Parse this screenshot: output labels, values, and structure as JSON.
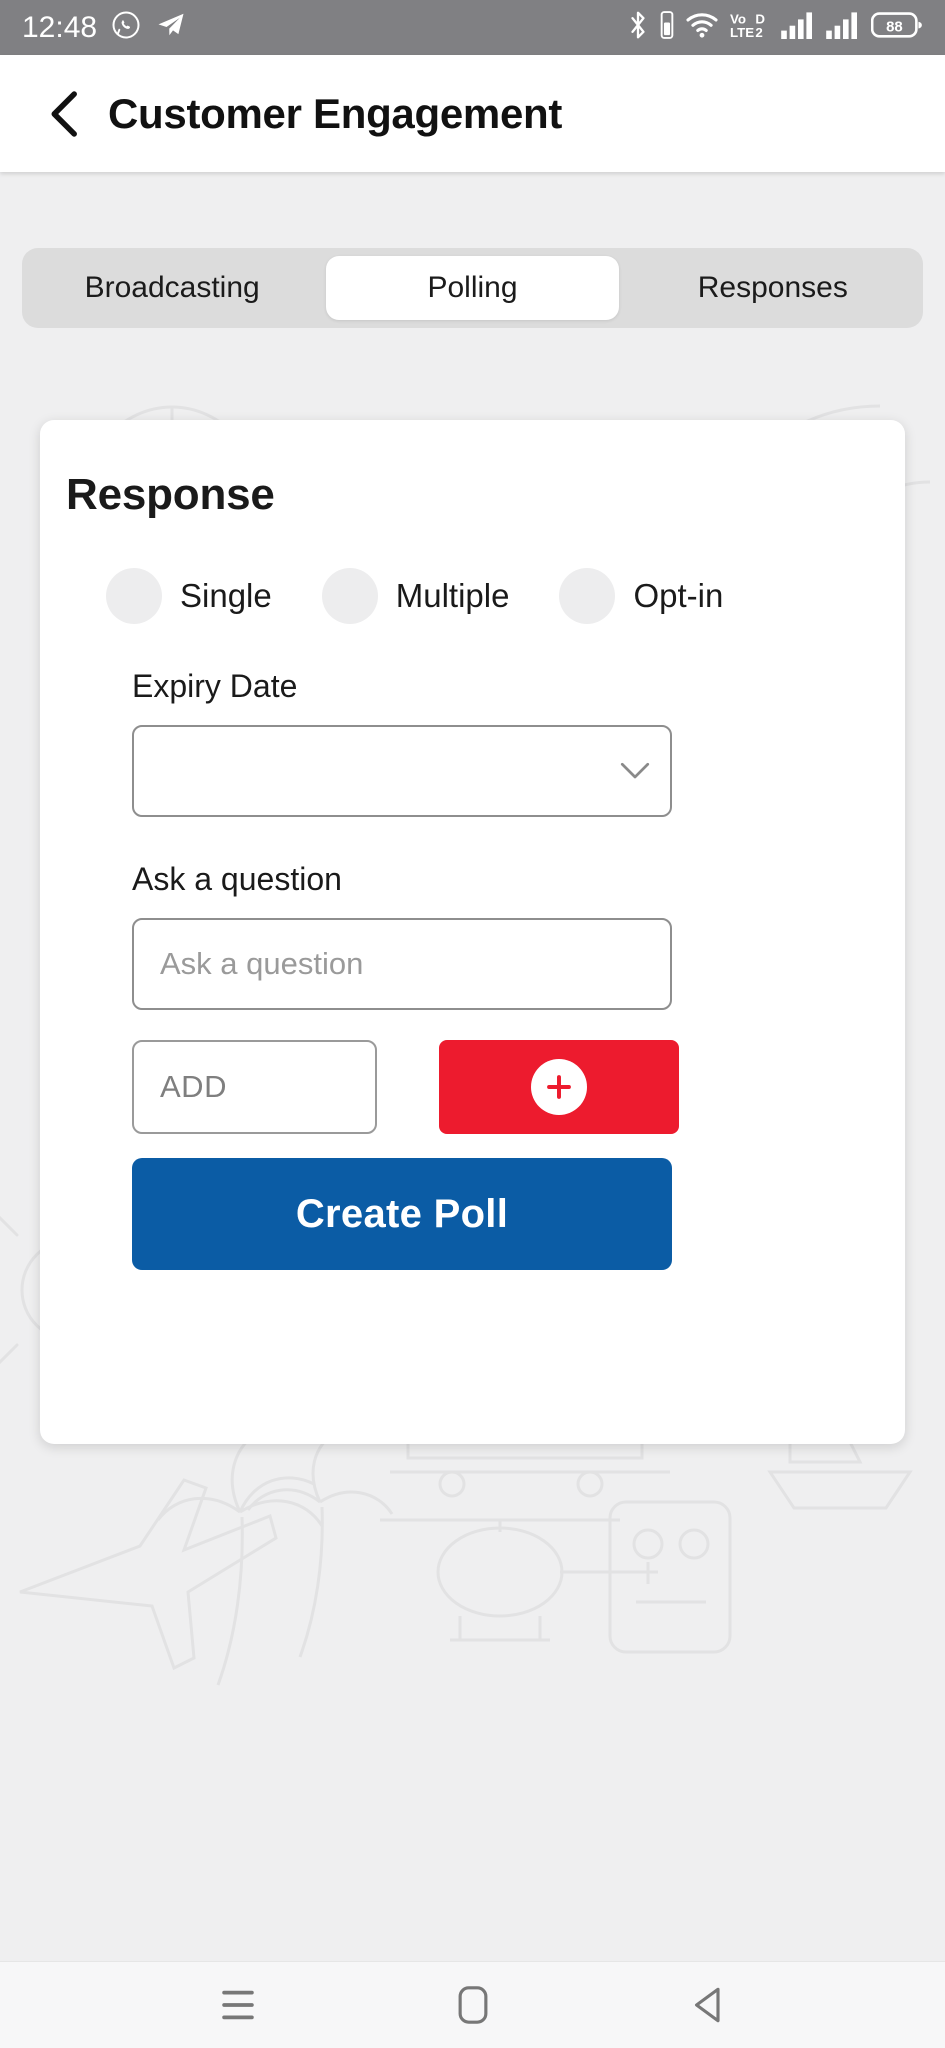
{
  "status_bar": {
    "time": "12:48",
    "left_icons": [
      "whatsapp-icon",
      "telegram-icon"
    ],
    "right_icons": [
      "bluetooth-icon",
      "bluetooth-battery-icon",
      "wifi-icon",
      "volte-icon",
      "signal-1-icon",
      "signal-2-icon"
    ],
    "volte_label_top": "VoD",
    "volte_label_bottom": "LTE2",
    "battery_level": "88",
    "background": "#808083"
  },
  "header": {
    "title": "Customer Engagement",
    "back_icon": "back-chevron-icon"
  },
  "tabs": [
    {
      "label": "Broadcasting",
      "active": false
    },
    {
      "label": "Polling",
      "active": true
    },
    {
      "label": "Responses",
      "active": false
    }
  ],
  "card": {
    "title": "Response",
    "response_options": [
      {
        "label": "Single",
        "selected": false
      },
      {
        "label": "Multiple",
        "selected": false
      },
      {
        "label": "Opt-in",
        "selected": false
      }
    ],
    "expiry": {
      "label": "Expiry Date",
      "value": "",
      "icon": "chevron-down-icon"
    },
    "question": {
      "label": "Ask a question",
      "value": "",
      "placeholder": "Ask a question"
    },
    "add": {
      "value": "",
      "placeholder": "ADD",
      "button_icon": "plus-icon",
      "button_color": "#ed1b2e"
    },
    "submit": {
      "label": "Create Poll",
      "color": "#0b5ca5"
    }
  },
  "nav_bar": {
    "buttons": [
      {
        "icon": "recents-menu-icon"
      },
      {
        "icon": "home-square-icon"
      },
      {
        "icon": "back-triangle-icon"
      }
    ]
  }
}
